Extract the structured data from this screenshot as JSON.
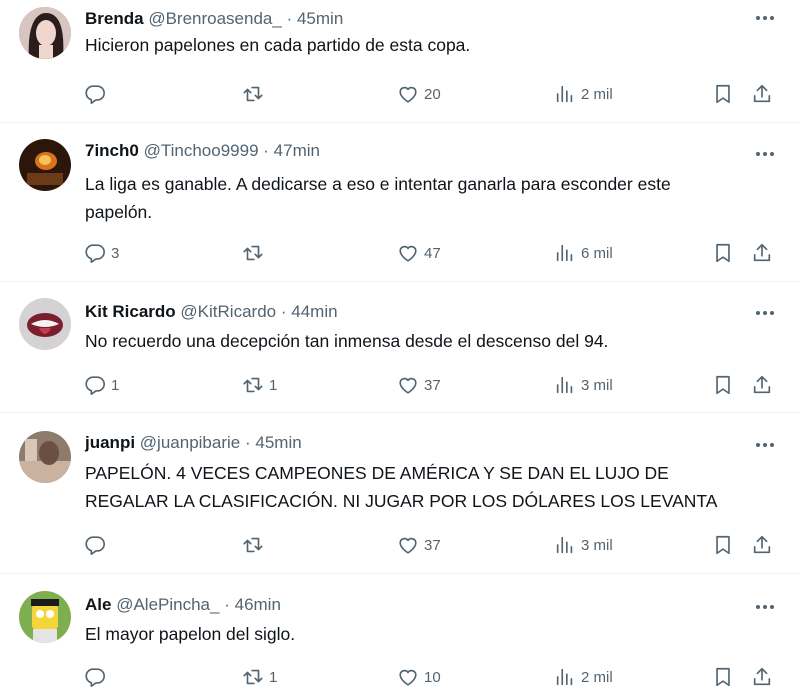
{
  "tweets": [
    {
      "name": "Brenda",
      "handle": "@Brenroasenda_",
      "sep": "·",
      "time": "45min",
      "lines": [
        "Hicieron papelones en cada partido de esta copa."
      ],
      "replies": "",
      "retweets": "",
      "likes": "20",
      "views": "2 mil"
    },
    {
      "name": "7inch0",
      "handle": "@Tinchoo9999",
      "sep": "·",
      "time": "47min",
      "lines": [
        "La liga es ganable. A dedicarse a eso e intentar ganarla para esconder este",
        "papelón."
      ],
      "replies": "3",
      "retweets": "",
      "likes": "47",
      "views": "6 mil"
    },
    {
      "name": "Kit Ricardo",
      "handle": "@KitRicardo",
      "sep": "·",
      "time": "44min",
      "lines": [
        "No recuerdo una decepción tan inmensa desde el descenso del 94."
      ],
      "replies": "1",
      "retweets": "1",
      "likes": "37",
      "views": "3 mil"
    },
    {
      "name": "juanpi",
      "handle": "@juanpibarie",
      "sep": "·",
      "time": "45min",
      "lines": [
        "PAPELÓN. 4 VECES CAMPEONES DE AMÉRICA Y SE DAN EL LUJO DE",
        "REGALAR LA CLASIFICACIÓN. NI JUGAR POR LOS DÓLARES LOS LEVANTA"
      ],
      "replies": "",
      "retweets": "",
      "likes": "37",
      "views": "3 mil"
    },
    {
      "name": "Ale",
      "handle": "@AlePincha_",
      "sep": "·",
      "time": "46min",
      "lines": [
        "El mayor papelon del siglo."
      ],
      "replies": "",
      "retweets": "1",
      "likes": "10",
      "views": "2 mil"
    }
  ],
  "icons": {
    "reply": "reply-icon",
    "retweet": "retweet-icon",
    "like": "heart-icon",
    "views": "views-icon",
    "bookmark": "bookmark-icon",
    "share": "share-icon",
    "more": "more-dots-icon"
  },
  "colors": {
    "text": "#0f1419",
    "muted": "#536471",
    "divider": "#eff3f4"
  }
}
